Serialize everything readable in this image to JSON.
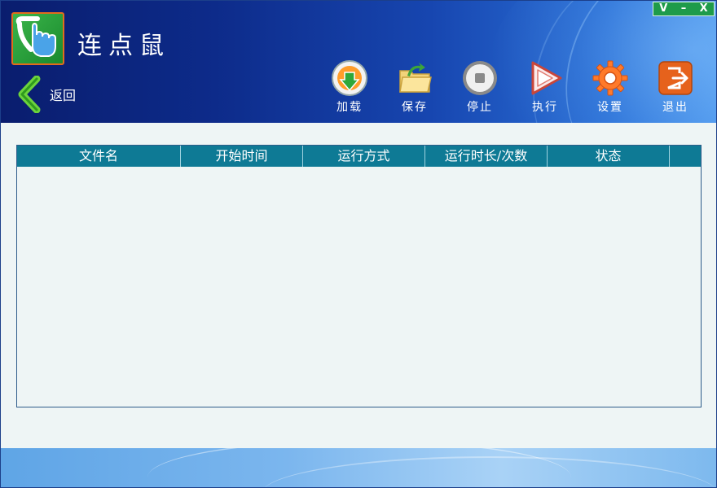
{
  "app": {
    "title": "连点鼠"
  },
  "window_controls": {
    "v_label": "V",
    "minimize_label": "–",
    "close_label": "X"
  },
  "nav": {
    "back_label": "返回"
  },
  "toolbar": {
    "load_label": "加载",
    "save_label": "保存",
    "stop_label": "停止",
    "run_label": "执行",
    "settings_label": "设置",
    "exit_label": "退出"
  },
  "table": {
    "columns": [
      "文件名",
      "开始时间",
      "运行方式",
      "运行时长/次数",
      "状态"
    ],
    "rows": []
  },
  "colors": {
    "header_dark": "#0a1d6e",
    "header_light": "#4d96ec",
    "table_header": "#0e7a95",
    "content_bg": "#eef5f5",
    "window_controls_bg": "#1e9b4a"
  },
  "icons": {
    "logo": "hand-pointer-icon",
    "back": "chevron-left-icon",
    "load": "download-icon",
    "save": "folder-icon",
    "stop": "stop-icon",
    "run": "play-icon",
    "settings": "gear-icon",
    "exit": "exit-icon"
  }
}
